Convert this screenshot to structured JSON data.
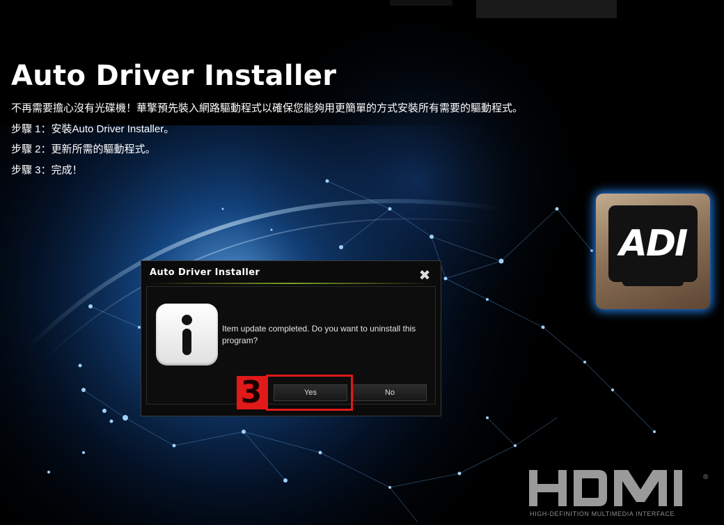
{
  "header": {
    "title": "Auto Driver Installer",
    "lines": [
      "不再需要擔心沒有光碟機！華擎預先裝入網路驅動程式以確保您能夠用更簡單的方式安裝所有需要的驅動程式。",
      "步驟 1：安裝Auto Driver Installer。",
      "步驟 2：更新所需的驅動程式。",
      "步驟 3：完成！"
    ]
  },
  "logo": {
    "text": "ADI"
  },
  "dialog": {
    "title": "Auto Driver Installer",
    "close_glyph": "✖",
    "message": "Item update completed. Do you want to uninstall this program?",
    "yes_label": "Yes",
    "no_label": "No"
  },
  "annotation": {
    "step_number": "3"
  },
  "hdmi": {
    "logo_text": "HDMI",
    "registered": "®",
    "tagline": "HIGH-DEFINITION MULTIMEDIA INTERFACE"
  },
  "colors": {
    "background": "#000000",
    "accent_glow": "#2a8cff",
    "annotation_red": "#e01919"
  }
}
